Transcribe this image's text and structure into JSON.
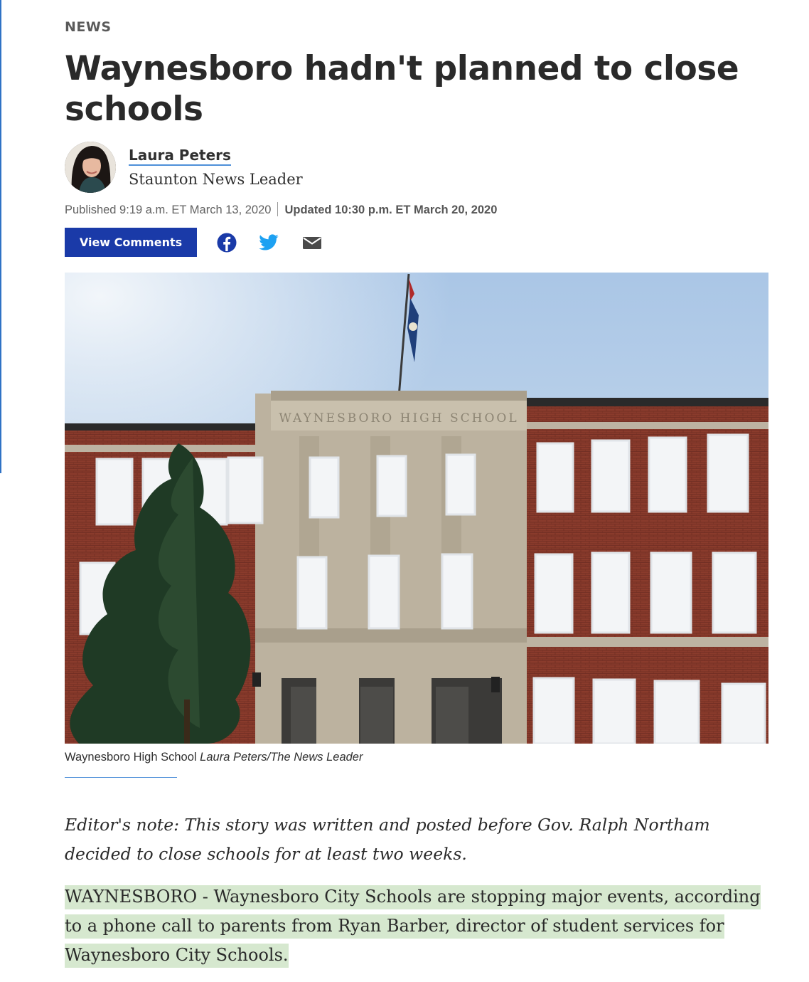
{
  "article": {
    "section": "NEWS",
    "headline": "Waynesboro hadn't planned to close schools",
    "author": {
      "name": "Laura Peters",
      "organization": "Staunton News Leader"
    },
    "published": "Published 9:19 a.m. ET March 13, 2020",
    "updated": "Updated 10:30 p.m. ET March 20, 2020",
    "actions": {
      "comments_label": "View Comments",
      "share_icons": [
        "facebook-icon",
        "twitter-icon",
        "email-icon"
      ]
    },
    "photo": {
      "building_inscription": "WAYNESBORO HIGH SCHOOL",
      "caption": "Waynesboro High School",
      "credit": "Laura Peters/The News Leader"
    },
    "editor_note": "Editor's note: This story was written and posted before Gov. Ralph Northam decided to close schools for at least two weeks.",
    "lede": "WAYNESBORO - Waynesboro City Schools are stopping major events, according to a phone call to parents from Ryan Barber, director of student services for Waynesboro City Schools."
  },
  "colors": {
    "accent_blue": "#1a3aa8",
    "link_underline": "#4d8fd9",
    "highlight": "#d6e8cf",
    "facebook": "#1877f2",
    "twitter": "#1da1f2"
  }
}
